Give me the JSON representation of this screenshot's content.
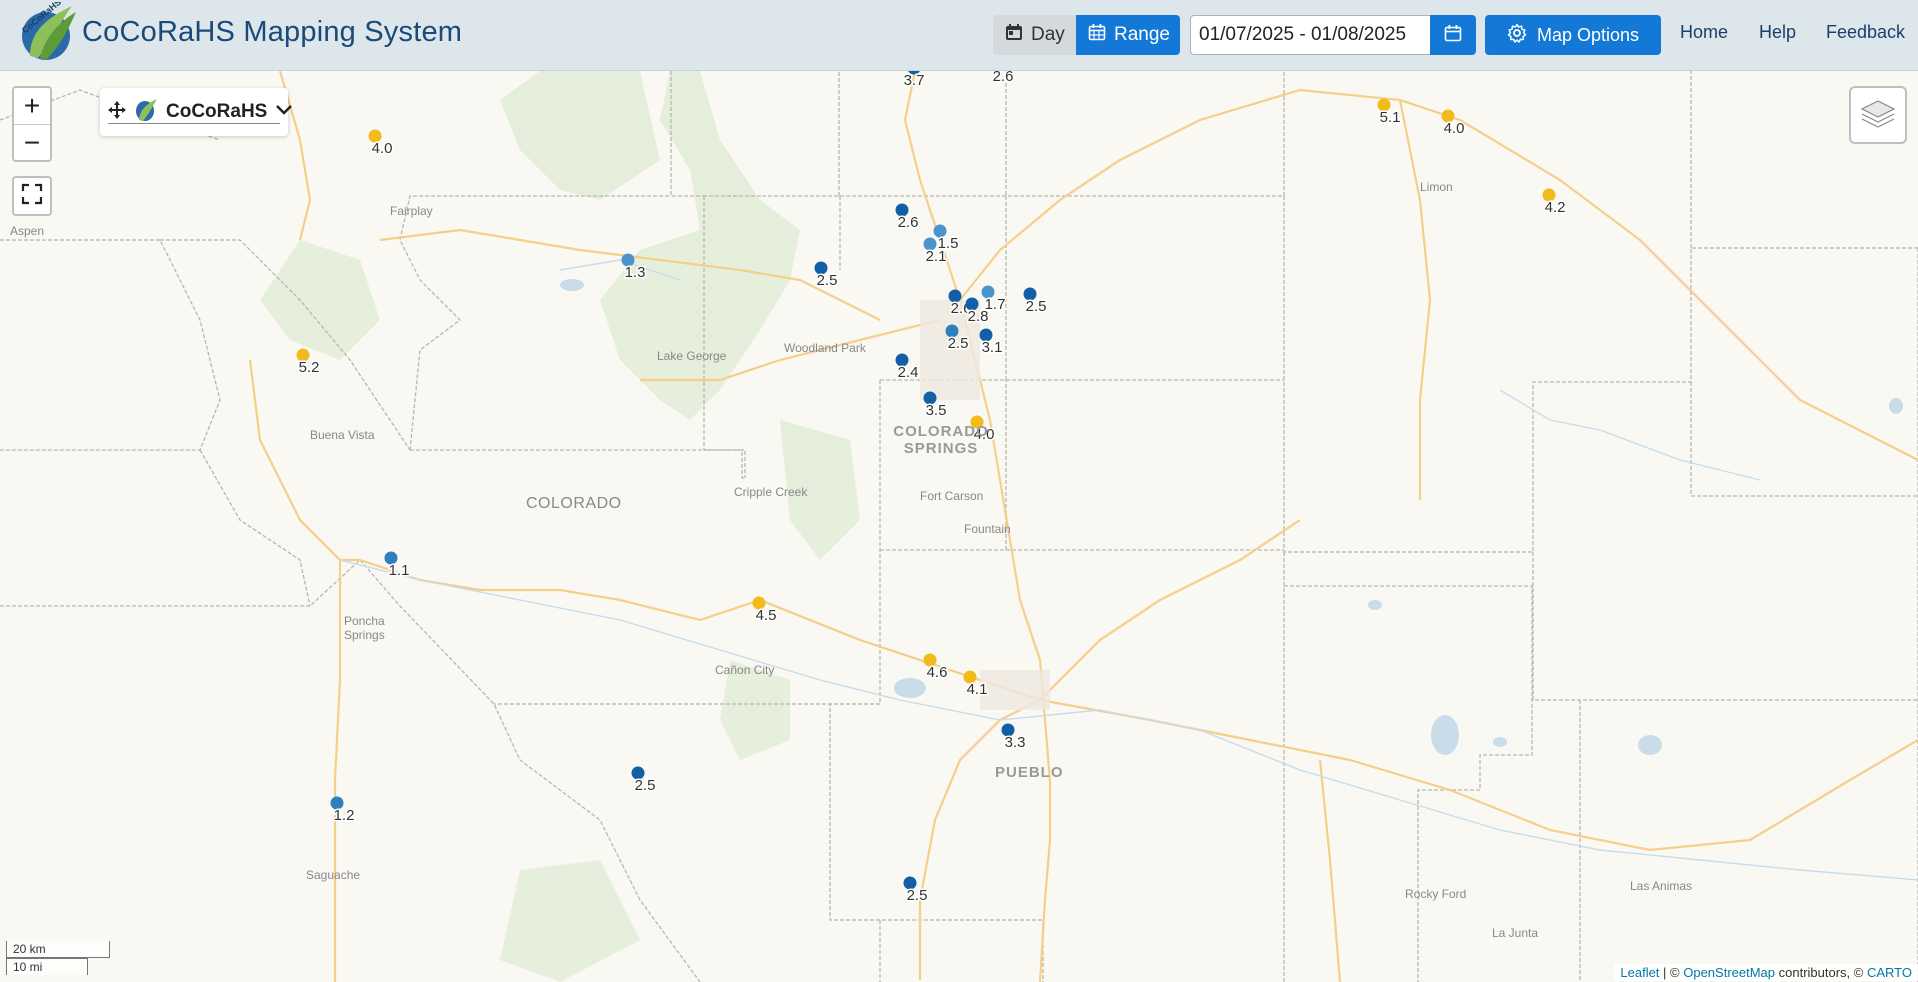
{
  "header": {
    "app_title": "CoCoRaHS Mapping System",
    "logo_text": "CoCoRaHS",
    "mode_day": "Day",
    "mode_range": "Range",
    "date_range": "01/07/2025 - 01/08/2025",
    "map_options": "Map Options",
    "nav": [
      "Home",
      "Help",
      "Feedback"
    ]
  },
  "map_controls": {
    "zoom_in": "+",
    "zoom_out": "−",
    "brand_label": "CoCoRaHS",
    "scale_km": "20 km",
    "scale_mi": "10 mi"
  },
  "attribution": {
    "leaflet": "Leaflet",
    "sep": " | © ",
    "osm": "OpenStreetMap",
    "contrib": " contributors, © ",
    "carto": "CARTO"
  },
  "colors": {
    "light_blue": "#4b93cf",
    "mid_blue": "#2f7ec0",
    "dark_blue": "#135fa6",
    "yellow": "#f2bb1c"
  },
  "places": [
    "Fairplay",
    "Lake George",
    "Woodland Park",
    "Buena Vista",
    "COLORADO",
    "Cripple Creek",
    "COLORADO SPRINGS",
    "Fort Carson",
    "Fountain",
    "Poncha Springs",
    "Cañon City",
    "PUEBLO",
    "Saguache",
    "Limon",
    "Rocky Ford",
    "Las Animas",
    "La Junta",
    "Aspen"
  ],
  "stations": [
    {
      "value": "3.7",
      "color": "dark_blue"
    },
    {
      "value": "2.6",
      "color": "dark_blue"
    },
    {
      "value": "4.0",
      "color": "yellow"
    },
    {
      "value": "5.1",
      "color": "yellow"
    },
    {
      "value": "4.0",
      "color": "yellow"
    },
    {
      "value": "4.2",
      "color": "yellow"
    },
    {
      "value": "2.6",
      "color": "dark_blue"
    },
    {
      "value": "1.5",
      "color": "light_blue"
    },
    {
      "value": "2.1",
      "color": "light_blue"
    },
    {
      "value": "1.3",
      "color": "light_blue"
    },
    {
      "value": "2.5",
      "color": "dark_blue"
    },
    {
      "value": "1.7",
      "color": "light_blue"
    },
    {
      "value": "2.5",
      "color": "dark_blue"
    },
    {
      "value": "2.6",
      "color": "dark_blue"
    },
    {
      "value": "2.8",
      "color": "dark_blue"
    },
    {
      "value": "2.5",
      "color": "mid_blue"
    },
    {
      "value": "3.1",
      "color": "dark_blue"
    },
    {
      "value": "2.4",
      "color": "dark_blue"
    },
    {
      "value": "5.2",
      "color": "yellow"
    },
    {
      "value": "3.5",
      "color": "dark_blue"
    },
    {
      "value": "4.0",
      "color": "yellow"
    },
    {
      "value": "1.1",
      "color": "mid_blue"
    },
    {
      "value": "4.5",
      "color": "yellow"
    },
    {
      "value": "4.6",
      "color": "yellow"
    },
    {
      "value": "4.1",
      "color": "yellow"
    },
    {
      "value": "3.3",
      "color": "dark_blue"
    },
    {
      "value": "2.5",
      "color": "dark_blue"
    },
    {
      "value": "1.2",
      "color": "mid_blue"
    },
    {
      "value": "2.5",
      "color": "dark_blue"
    }
  ]
}
